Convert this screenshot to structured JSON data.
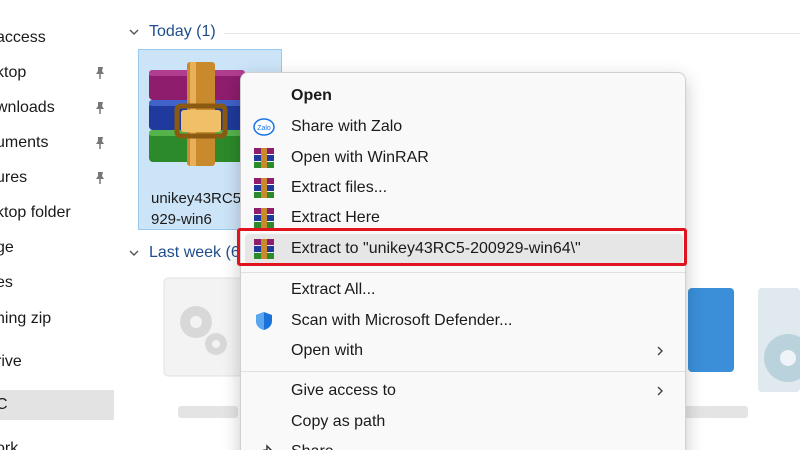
{
  "sidebar": {
    "items": [
      {
        "label": "access",
        "pinned": false
      },
      {
        "label": "ktop",
        "pinned": true
      },
      {
        "label": "wnloads",
        "pinned": true
      },
      {
        "label": "uments",
        "pinned": true
      },
      {
        "label": "ures",
        "pinned": true
      },
      {
        "label": "ktop folder",
        "pinned": false
      },
      {
        "label": "ge",
        "pinned": false
      },
      {
        "label": "es",
        "pinned": false
      },
      {
        "label": "ning zip",
        "pinned": false
      },
      {
        "label": "rive",
        "pinned": false
      },
      {
        "label": "C",
        "pinned": false,
        "selected": true
      },
      {
        "label": "ork",
        "pinned": false
      }
    ]
  },
  "groups": {
    "today": {
      "label": "Today (1)"
    },
    "last_week": {
      "label": "Last week (6"
    }
  },
  "file": {
    "name_line1": "unikey43RC5",
    "name_line2": "929-win6",
    "icon": "winrar-archive-icon"
  },
  "menu": {
    "items": [
      {
        "label": "Open",
        "icon": "",
        "bold": true
      },
      {
        "label": "Share with Zalo",
        "icon": "zalo-icon"
      },
      {
        "label": "Open with WinRAR",
        "icon": "winrar-icon"
      },
      {
        "label": "Extract files...",
        "icon": "winrar-icon"
      },
      {
        "label": "Extract Here",
        "icon": "winrar-icon"
      },
      {
        "label": "Extract to \"unikey43RC5-200929-win64\\\"",
        "icon": "winrar-icon",
        "highlighted": true
      },
      {
        "label": "Extract All...",
        "icon": ""
      },
      {
        "label": "Scan with Microsoft Defender...",
        "icon": "defender-shield-icon"
      },
      {
        "label": "Open with",
        "icon": "",
        "submenu": true
      },
      {
        "label": "Give access to",
        "icon": "",
        "submenu": true
      },
      {
        "label": "Copy as path",
        "icon": ""
      },
      {
        "label": "Share",
        "icon": "share-icon"
      }
    ]
  },
  "colors": {
    "highlight_box": "#e0141f",
    "group_header": "#1f4e8c",
    "selection": "#cce4f7"
  }
}
